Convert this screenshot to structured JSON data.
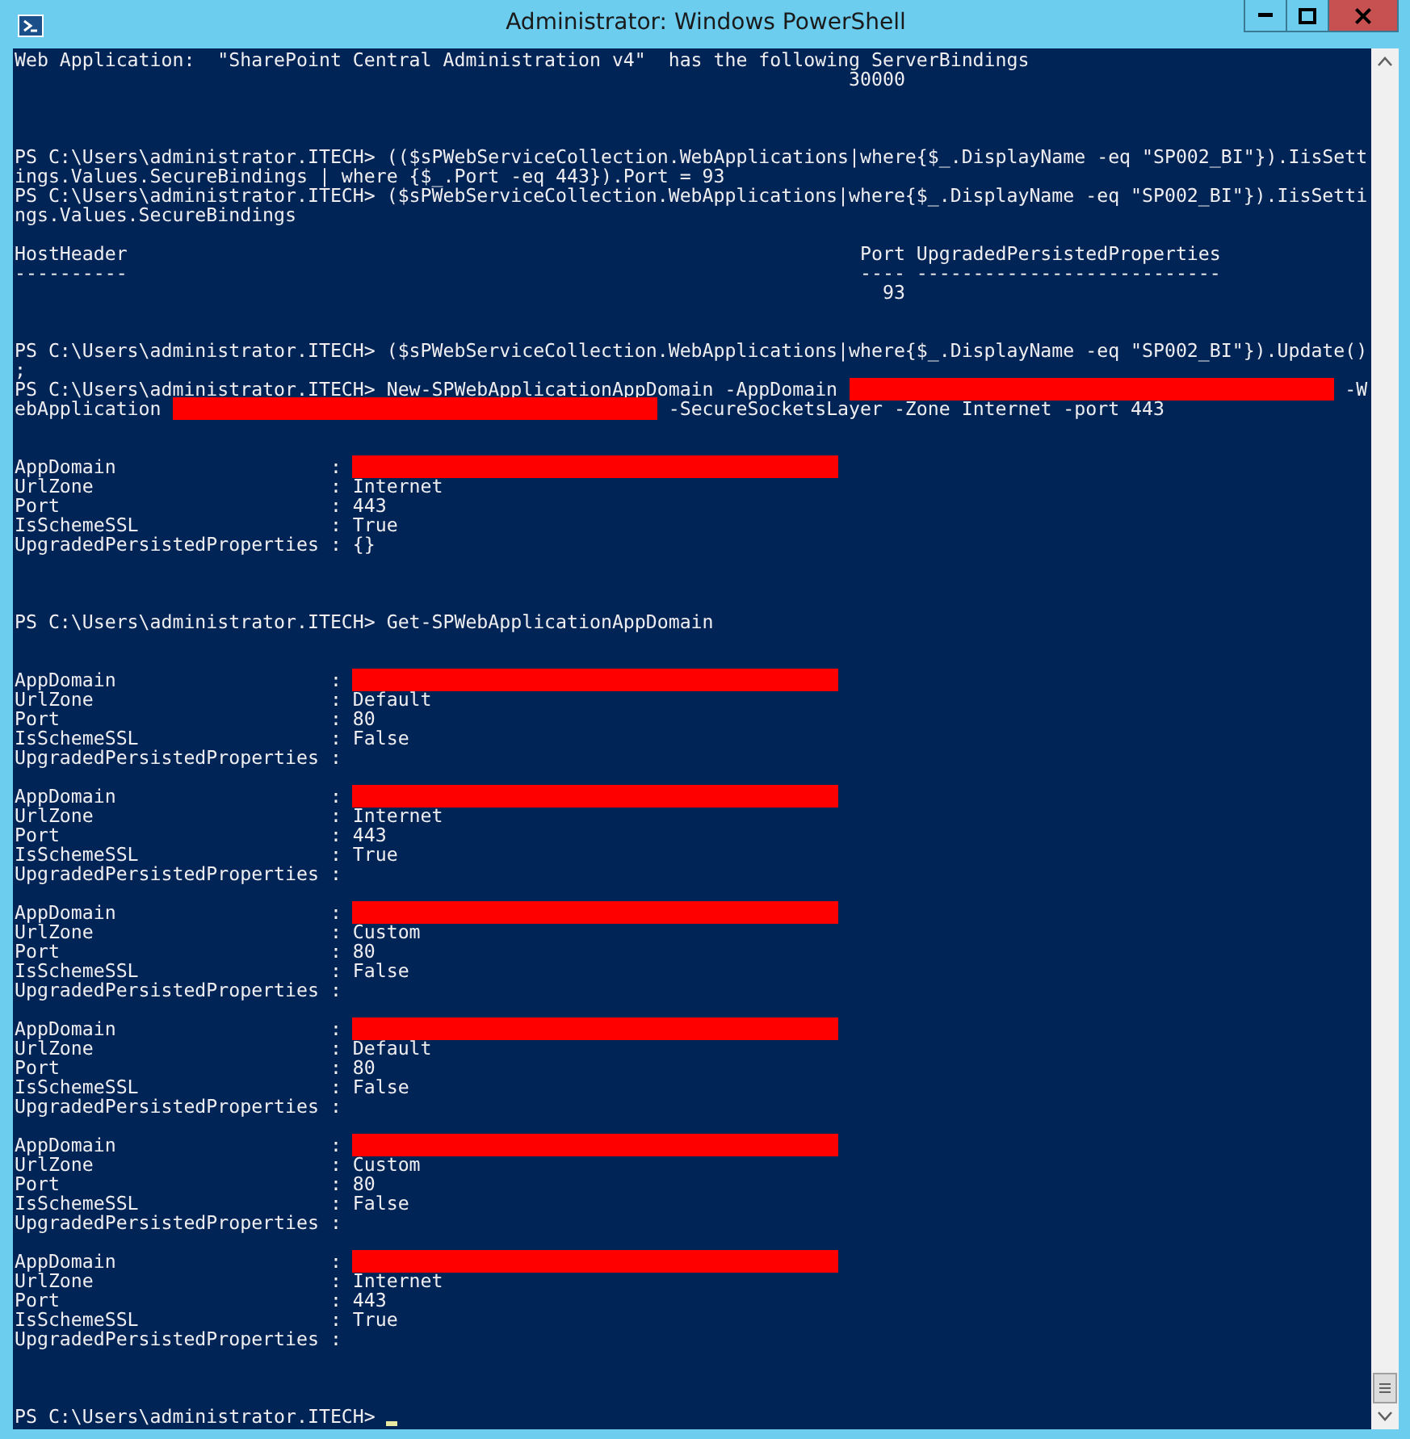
{
  "window": {
    "title": "Administrator: Windows PowerShell",
    "buttons": [
      {
        "kind": "minimize"
      },
      {
        "kind": "maximize"
      },
      {
        "kind": "close"
      }
    ]
  },
  "console": {
    "lines": [
      {
        "kind": "text",
        "text": "Web Application:  \"SharePoint Central Administration v4\"  has the following ServerBindings"
      },
      {
        "kind": "text",
        "text": "                                                                          30000"
      },
      {
        "kind": "blank"
      },
      {
        "kind": "blank"
      },
      {
        "kind": "blank"
      },
      {
        "kind": "text",
        "text": "PS C:\\Users\\administrator.ITECH> (($sPWebServiceCollection.WebApplications|where{$_.DisplayName -eq \"SP002_BI\"}).IisSett"
      },
      {
        "kind": "text",
        "text": "ings.Values.SecureBindings | where {$_.Port -eq 443}).Port = 93"
      },
      {
        "kind": "text",
        "text": "PS C:\\Users\\administrator.ITECH> ($sPWebServiceCollection.WebApplications|where{$_.DisplayName -eq \"SP002_BI\"}).IisSetti"
      },
      {
        "kind": "text",
        "text": "ngs.Values.SecureBindings"
      },
      {
        "kind": "blank"
      },
      {
        "kind": "text",
        "text": "HostHeader                                                                 Port UpgradedPersistedProperties"
      },
      {
        "kind": "text",
        "text": "----------                                                                 ---- ---------------------------"
      },
      {
        "kind": "text",
        "text": "                                                                             93"
      },
      {
        "kind": "blank"
      },
      {
        "kind": "blank"
      },
      {
        "kind": "text",
        "text": "PS C:\\Users\\administrator.ITECH> ($sPWebServiceCollection.WebApplications|where{$_.DisplayName -eq \"SP002_BI\"}).Update()"
      },
      {
        "kind": "text",
        "text": ";"
      },
      {
        "kind": "redacted",
        "before": "PS C:\\Users\\administrator.ITECH> New-SPWebApplicationAppDomain -AppDomain ",
        "after": " -W"
      },
      {
        "kind": "redacted",
        "before": "ebApplication ",
        "after": " -SecureSocketsLayer -Zone Internet -port 443"
      },
      {
        "kind": "blank"
      },
      {
        "kind": "blank"
      },
      {
        "kind": "redacted",
        "before": "AppDomain                   : "
      },
      {
        "kind": "text",
        "text": "UrlZone                     : Internet"
      },
      {
        "kind": "text",
        "text": "Port                        : 443"
      },
      {
        "kind": "text",
        "text": "IsSchemeSSL                 : True"
      },
      {
        "kind": "text",
        "text": "UpgradedPersistedProperties : {}"
      },
      {
        "kind": "blank"
      },
      {
        "kind": "blank"
      },
      {
        "kind": "blank"
      },
      {
        "kind": "text",
        "text": "PS C:\\Users\\administrator.ITECH> Get-SPWebApplicationAppDomain"
      },
      {
        "kind": "blank"
      },
      {
        "kind": "blank"
      },
      {
        "kind": "redacted",
        "before": "AppDomain                   : "
      },
      {
        "kind": "text",
        "text": "UrlZone                     : Default"
      },
      {
        "kind": "text",
        "text": "Port                        : 80"
      },
      {
        "kind": "text",
        "text": "IsSchemeSSL                 : False"
      },
      {
        "kind": "text",
        "text": "UpgradedPersistedProperties :"
      },
      {
        "kind": "blank"
      },
      {
        "kind": "redacted",
        "before": "AppDomain                   : "
      },
      {
        "kind": "text",
        "text": "UrlZone                     : Internet"
      },
      {
        "kind": "text",
        "text": "Port                        : 443"
      },
      {
        "kind": "text",
        "text": "IsSchemeSSL                 : True"
      },
      {
        "kind": "text",
        "text": "UpgradedPersistedProperties :"
      },
      {
        "kind": "blank"
      },
      {
        "kind": "redacted",
        "before": "AppDomain                   : "
      },
      {
        "kind": "text",
        "text": "UrlZone                     : Custom"
      },
      {
        "kind": "text",
        "text": "Port                        : 80"
      },
      {
        "kind": "text",
        "text": "IsSchemeSSL                 : False"
      },
      {
        "kind": "text",
        "text": "UpgradedPersistedProperties :"
      },
      {
        "kind": "blank"
      },
      {
        "kind": "redacted",
        "before": "AppDomain                   : "
      },
      {
        "kind": "text",
        "text": "UrlZone                     : Default"
      },
      {
        "kind": "text",
        "text": "Port                        : 80"
      },
      {
        "kind": "text",
        "text": "IsSchemeSSL                 : False"
      },
      {
        "kind": "text",
        "text": "UpgradedPersistedProperties :"
      },
      {
        "kind": "blank"
      },
      {
        "kind": "redacted",
        "before": "AppDomain                   : "
      },
      {
        "kind": "text",
        "text": "UrlZone                     : Custom"
      },
      {
        "kind": "text",
        "text": "Port                        : 80"
      },
      {
        "kind": "text",
        "text": "IsSchemeSSL                 : False"
      },
      {
        "kind": "text",
        "text": "UpgradedPersistedProperties :"
      },
      {
        "kind": "blank"
      },
      {
        "kind": "redacted",
        "before": "AppDomain                   : "
      },
      {
        "kind": "text",
        "text": "UrlZone                     : Internet"
      },
      {
        "kind": "text",
        "text": "Port                        : 443"
      },
      {
        "kind": "text",
        "text": "IsSchemeSSL                 : True"
      },
      {
        "kind": "text",
        "text": "UpgradedPersistedProperties :"
      },
      {
        "kind": "blank"
      },
      {
        "kind": "blank"
      },
      {
        "kind": "blank"
      },
      {
        "kind": "prompt",
        "text": "PS C:\\Users\\administrator.ITECH> "
      }
    ]
  }
}
